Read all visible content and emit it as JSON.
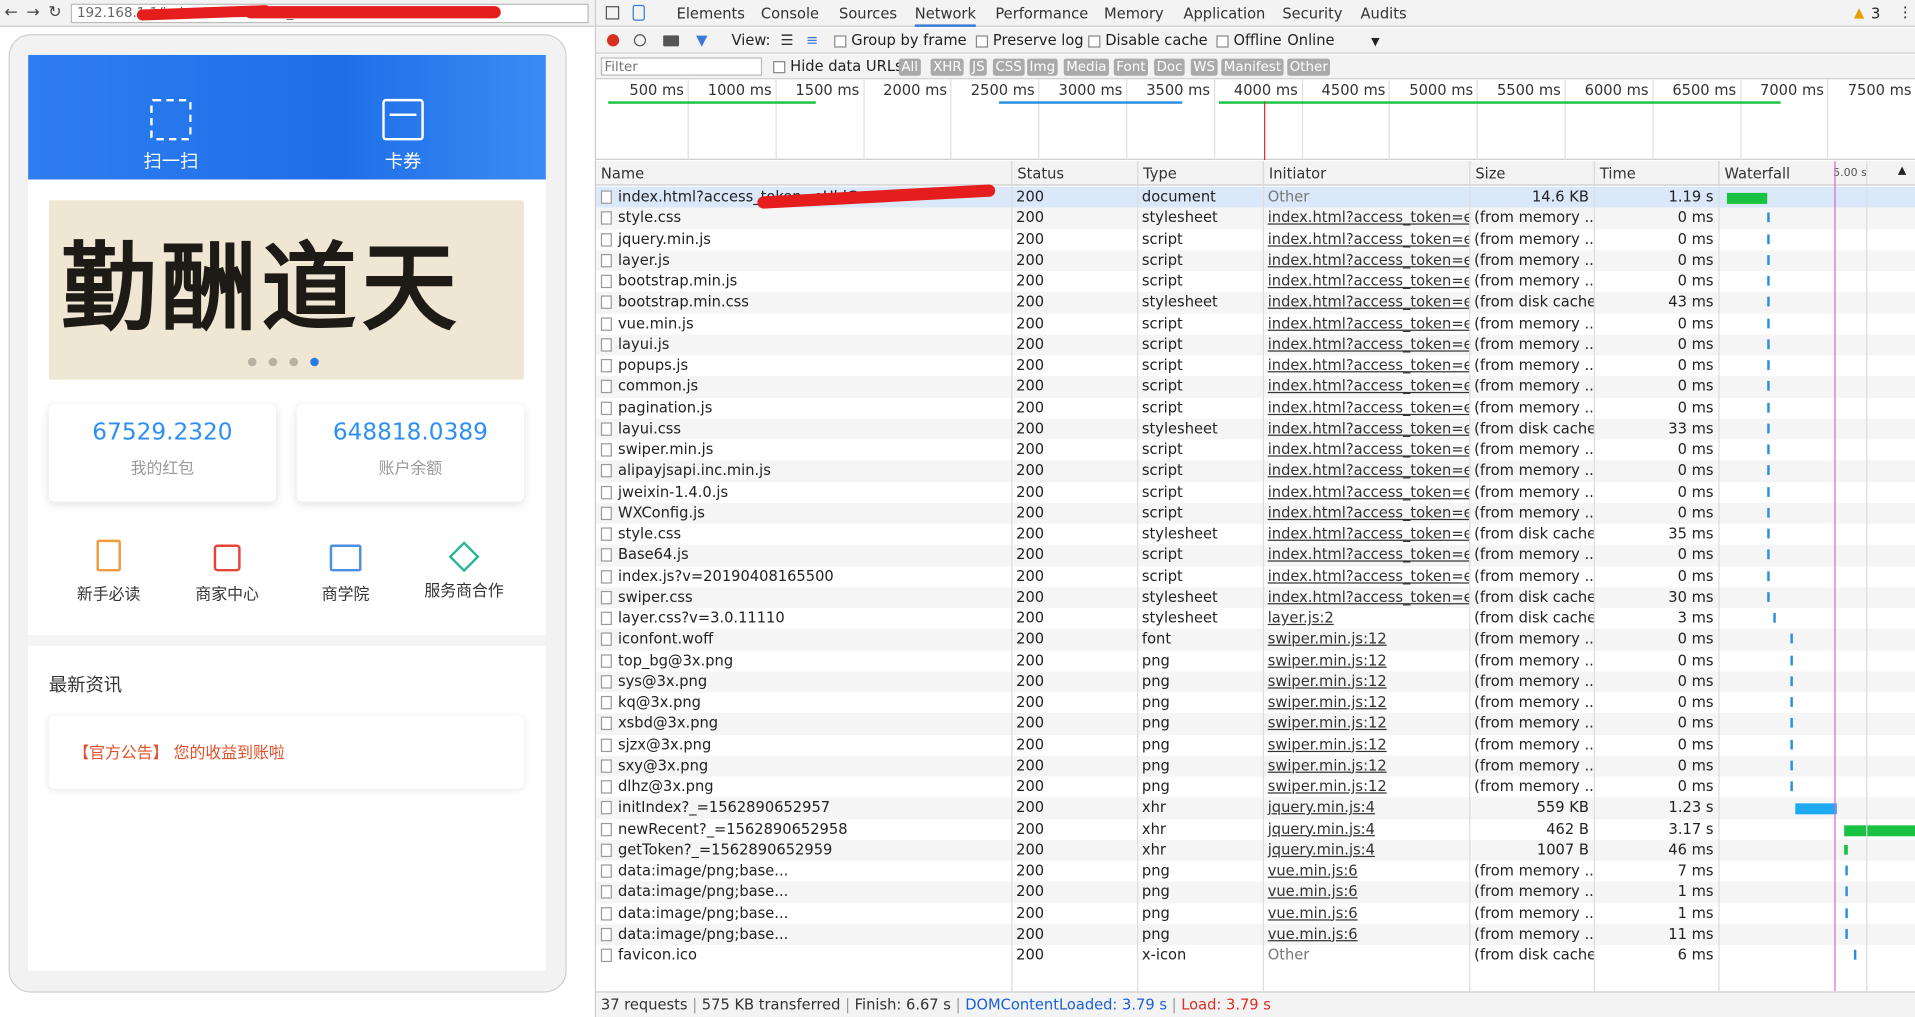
{
  "browser": {
    "url": "192.168.1.1/index.html?access_token=eUhlG...RS=CI0RE",
    "nav": {
      "back": "←",
      "forward": "→",
      "reload": "↻"
    }
  },
  "app": {
    "hero": {
      "scan_label": "扫一扫",
      "card_label": "卡券"
    },
    "banner": {
      "calligraphy": "勤酬道天",
      "slide_count": 4,
      "active_slide": 4
    },
    "stats": [
      {
        "value": "67529.2320",
        "label": "我的红包"
      },
      {
        "value": "648818.0389",
        "label": "账户余额"
      }
    ],
    "menu": [
      {
        "label": "新手必读",
        "icon": "book-icon",
        "color": "#f19a3e"
      },
      {
        "label": "商家中心",
        "icon": "shopping-bag-icon",
        "color": "#e8433a"
      },
      {
        "label": "商学院",
        "icon": "open-book-icon",
        "color": "#4a8fe0"
      },
      {
        "label": "服务商合作",
        "icon": "handshake-icon",
        "color": "#2bb596"
      }
    ],
    "news": {
      "title": "最新资讯",
      "item": "【官方公告】 您的收益到账啦"
    }
  },
  "devtools": {
    "tabs": [
      "Elements",
      "Console",
      "Sources",
      "Network",
      "Performance",
      "Memory",
      "Application",
      "Security",
      "Audits"
    ],
    "active_tab": "Network",
    "warning_count": "3",
    "toolbar": {
      "view_label": "View:",
      "group_by_frame": "Group by frame",
      "preserve_log": "Preserve log",
      "disable_cache": "Disable cache",
      "offline": "Offline",
      "throttle": "Online"
    },
    "filter": {
      "placeholder": "Filter",
      "hide_data_urls": "Hide data URLs",
      "types": [
        "All",
        "XHR",
        "JS",
        "CSS",
        "Img",
        "Media",
        "Font",
        "Doc",
        "WS",
        "Manifest",
        "Other"
      ]
    },
    "overview_ticks": [
      "500 ms",
      "1000 ms",
      "1500 ms",
      "2000 ms",
      "2500 ms",
      "3000 ms",
      "3500 ms",
      "4000 ms",
      "4500 ms",
      "5000 ms",
      "5500 ms",
      "6000 ms",
      "6500 ms",
      "7000 ms",
      "7500 ms"
    ],
    "columns": [
      "Name",
      "Status",
      "Type",
      "Initiator",
      "Size",
      "Time",
      "Waterfall"
    ],
    "waterfall_scale": "5.00 s",
    "rows": [
      {
        "name": "index.html?access_token=eUhlG...",
        "status": "200",
        "type": "document",
        "initiator": "Other",
        "size": "14.6 KB",
        "time": "1.19 s",
        "wf_start": 0.0,
        "wf_dur": 1.19,
        "wf_color": "#19c242"
      },
      {
        "name": "style.css",
        "status": "200",
        "type": "stylesheet",
        "initiator": "index.html?access_token=e...",
        "size": "(from memory ...",
        "time": "0 ms",
        "wf_start": 1.2,
        "wf_dur": 0.05,
        "wf_color": "#2a8ee0"
      },
      {
        "name": "jquery.min.js",
        "status": "200",
        "type": "script",
        "initiator": "index.html?access_token=e...",
        "size": "(from memory ...",
        "time": "0 ms",
        "wf_start": 1.2,
        "wf_dur": 0.05,
        "wf_color": "#2a8ee0"
      },
      {
        "name": "layer.js",
        "status": "200",
        "type": "script",
        "initiator": "index.html?access_token=e...",
        "size": "(from memory ...",
        "time": "0 ms",
        "wf_start": 1.2,
        "wf_dur": 0.05,
        "wf_color": "#2a8ee0"
      },
      {
        "name": "bootstrap.min.js",
        "status": "200",
        "type": "script",
        "initiator": "index.html?access_token=e...",
        "size": "(from memory ...",
        "time": "0 ms",
        "wf_start": 1.2,
        "wf_dur": 0.05,
        "wf_color": "#2a8ee0"
      },
      {
        "name": "bootstrap.min.css",
        "status": "200",
        "type": "stylesheet",
        "initiator": "index.html?access_token=e...",
        "size": "(from disk cache)",
        "time": "43 ms",
        "wf_start": 1.2,
        "wf_dur": 0.08,
        "wf_color": "#2a8ee0"
      },
      {
        "name": "vue.min.js",
        "status": "200",
        "type": "script",
        "initiator": "index.html?access_token=e...",
        "size": "(from memory ...",
        "time": "0 ms",
        "wf_start": 1.2,
        "wf_dur": 0.05,
        "wf_color": "#2a8ee0"
      },
      {
        "name": "layui.js",
        "status": "200",
        "type": "script",
        "initiator": "index.html?access_token=e...",
        "size": "(from memory ...",
        "time": "0 ms",
        "wf_start": 1.2,
        "wf_dur": 0.05,
        "wf_color": "#2a8ee0"
      },
      {
        "name": "popups.js",
        "status": "200",
        "type": "script",
        "initiator": "index.html?access_token=e...",
        "size": "(from memory ...",
        "time": "0 ms",
        "wf_start": 1.2,
        "wf_dur": 0.05,
        "wf_color": "#2a8ee0"
      },
      {
        "name": "common.js",
        "status": "200",
        "type": "script",
        "initiator": "index.html?access_token=e...",
        "size": "(from memory ...",
        "time": "0 ms",
        "wf_start": 1.2,
        "wf_dur": 0.05,
        "wf_color": "#2a8ee0"
      },
      {
        "name": "pagination.js",
        "status": "200",
        "type": "script",
        "initiator": "index.html?access_token=e...",
        "size": "(from memory ...",
        "time": "0 ms",
        "wf_start": 1.2,
        "wf_dur": 0.05,
        "wf_color": "#2a8ee0"
      },
      {
        "name": "layui.css",
        "status": "200",
        "type": "stylesheet",
        "initiator": "index.html?access_token=e...",
        "size": "(from disk cache)",
        "time": "33 ms",
        "wf_start": 1.2,
        "wf_dur": 0.08,
        "wf_color": "#2a8ee0"
      },
      {
        "name": "swiper.min.js",
        "status": "200",
        "type": "script",
        "initiator": "index.html?access_token=e...",
        "size": "(from memory ...",
        "time": "0 ms",
        "wf_start": 1.2,
        "wf_dur": 0.05,
        "wf_color": "#2a8ee0"
      },
      {
        "name": "alipayjsapi.inc.min.js",
        "status": "200",
        "type": "script",
        "initiator": "index.html?access_token=e...",
        "size": "(from memory ...",
        "time": "0 ms",
        "wf_start": 1.2,
        "wf_dur": 0.05,
        "wf_color": "#2a8ee0"
      },
      {
        "name": "jweixin-1.4.0.js",
        "status": "200",
        "type": "script",
        "initiator": "index.html?access_token=e...",
        "size": "(from memory ...",
        "time": "0 ms",
        "wf_start": 1.2,
        "wf_dur": 0.05,
        "wf_color": "#2a8ee0"
      },
      {
        "name": "WXConfig.js",
        "status": "200",
        "type": "script",
        "initiator": "index.html?access_token=e...",
        "size": "(from memory ...",
        "time": "0 ms",
        "wf_start": 1.2,
        "wf_dur": 0.05,
        "wf_color": "#2a8ee0"
      },
      {
        "name": "style.css",
        "status": "200",
        "type": "stylesheet",
        "initiator": "index.html?access_token=e...",
        "size": "(from disk cache)",
        "time": "35 ms",
        "wf_start": 1.2,
        "wf_dur": 0.08,
        "wf_color": "#2a8ee0"
      },
      {
        "name": "Base64.js",
        "status": "200",
        "type": "script",
        "initiator": "index.html?access_token=e...",
        "size": "(from memory ...",
        "time": "0 ms",
        "wf_start": 1.2,
        "wf_dur": 0.05,
        "wf_color": "#2a8ee0"
      },
      {
        "name": "index.js?v=20190408165500",
        "status": "200",
        "type": "script",
        "initiator": "index.html?access_token=e...",
        "size": "(from memory ...",
        "time": "0 ms",
        "wf_start": 1.2,
        "wf_dur": 0.05,
        "wf_color": "#2a8ee0"
      },
      {
        "name": "swiper.css",
        "status": "200",
        "type": "stylesheet",
        "initiator": "index.html?access_token=e...",
        "size": "(from disk cache)",
        "time": "30 ms",
        "wf_start": 1.2,
        "wf_dur": 0.08,
        "wf_color": "#2a8ee0"
      },
      {
        "name": "layer.css?v=3.0.11110",
        "status": "200",
        "type": "stylesheet",
        "initiator": "layer.js:2",
        "size": "(from disk cache)",
        "time": "3 ms",
        "wf_start": 1.4,
        "wf_dur": 0.05,
        "wf_color": "#2a8ee0"
      },
      {
        "name": "iconfont.woff",
        "status": "200",
        "type": "font",
        "initiator": "swiper.min.js:12",
        "size": "(from memory ...",
        "time": "0 ms",
        "wf_start": 1.9,
        "wf_dur": 0.05,
        "wf_color": "#2a8ee0"
      },
      {
        "name": "top_bg@3x.png",
        "status": "200",
        "type": "png",
        "initiator": "swiper.min.js:12",
        "size": "(from memory ...",
        "time": "0 ms",
        "wf_start": 1.9,
        "wf_dur": 0.05,
        "wf_color": "#2a8ee0"
      },
      {
        "name": "sys@3x.png",
        "status": "200",
        "type": "png",
        "initiator": "swiper.min.js:12",
        "size": "(from memory ...",
        "time": "0 ms",
        "wf_start": 1.9,
        "wf_dur": 0.05,
        "wf_color": "#2a8ee0"
      },
      {
        "name": "kq@3x.png",
        "status": "200",
        "type": "png",
        "initiator": "swiper.min.js:12",
        "size": "(from memory ...",
        "time": "0 ms",
        "wf_start": 1.9,
        "wf_dur": 0.05,
        "wf_color": "#2a8ee0"
      },
      {
        "name": "xsbd@3x.png",
        "status": "200",
        "type": "png",
        "initiator": "swiper.min.js:12",
        "size": "(from memory ...",
        "time": "0 ms",
        "wf_start": 1.9,
        "wf_dur": 0.05,
        "wf_color": "#2a8ee0"
      },
      {
        "name": "sjzx@3x.png",
        "status": "200",
        "type": "png",
        "initiator": "swiper.min.js:12",
        "size": "(from memory ...",
        "time": "0 ms",
        "wf_start": 1.9,
        "wf_dur": 0.05,
        "wf_color": "#2a8ee0"
      },
      {
        "name": "sxy@3x.png",
        "status": "200",
        "type": "png",
        "initiator": "swiper.min.js:12",
        "size": "(from memory ...",
        "time": "0 ms",
        "wf_start": 1.9,
        "wf_dur": 0.05,
        "wf_color": "#2a8ee0"
      },
      {
        "name": "dlhz@3x.png",
        "status": "200",
        "type": "png",
        "initiator": "swiper.min.js:12",
        "size": "(from memory ...",
        "time": "0 ms",
        "wf_start": 1.9,
        "wf_dur": 0.05,
        "wf_color": "#2a8ee0"
      },
      {
        "name": "initIndex?_=1562890652957",
        "status": "200",
        "type": "xhr",
        "initiator": "jquery.min.js:4",
        "size": "559 KB",
        "time": "1.23 s",
        "wf_start": 2.05,
        "wf_dur": 1.23,
        "wf_color": "#1eaaf1"
      },
      {
        "name": "newRecent?_=1562890652958",
        "status": "200",
        "type": "xhr",
        "initiator": "jquery.min.js:4",
        "size": "462 B",
        "time": "3.17 s",
        "wf_start": 3.5,
        "wf_dur": 3.17,
        "wf_color": "#19c242"
      },
      {
        "name": "getToken?_=1562890652959",
        "status": "200",
        "type": "xhr",
        "initiator": "jquery.min.js:4",
        "size": "1007 B",
        "time": "46 ms",
        "wf_start": 3.5,
        "wf_dur": 0.1,
        "wf_color": "#19c242"
      },
      {
        "name": "data:image/png;base...",
        "status": "200",
        "type": "png",
        "initiator": "vue.min.js:6",
        "size": "(from memory ...",
        "time": "7 ms",
        "wf_start": 3.55,
        "wf_dur": 0.05,
        "wf_color": "#2a8ee0"
      },
      {
        "name": "data:image/png;base...",
        "status": "200",
        "type": "png",
        "initiator": "vue.min.js:6",
        "size": "(from memory ...",
        "time": "1 ms",
        "wf_start": 3.55,
        "wf_dur": 0.05,
        "wf_color": "#2a8ee0"
      },
      {
        "name": "data:image/png;base...",
        "status": "200",
        "type": "png",
        "initiator": "vue.min.js:6",
        "size": "(from memory ...",
        "time": "1 ms",
        "wf_start": 3.55,
        "wf_dur": 0.05,
        "wf_color": "#2a8ee0"
      },
      {
        "name": "data:image/png;base...",
        "status": "200",
        "type": "png",
        "initiator": "vue.min.js:6",
        "size": "(from memory ...",
        "time": "11 ms",
        "wf_start": 3.55,
        "wf_dur": 0.05,
        "wf_color": "#2a8ee0"
      },
      {
        "name": "favicon.ico",
        "status": "200",
        "type": "x-icon",
        "initiator": "Other",
        "size": "(from disk cache)",
        "time": "6 ms",
        "wf_start": 3.8,
        "wf_dur": 0.05,
        "wf_color": "#2a8ee0"
      }
    ],
    "status": {
      "requests": "37 requests",
      "transferred": "575 KB transferred",
      "finish": "Finish: 6.67 s",
      "dom": "DOMContentLoaded: 3.79 s",
      "load": "Load: 3.79 s",
      "dom_color": "#1a5fd6",
      "load_color": "#d93025"
    }
  }
}
